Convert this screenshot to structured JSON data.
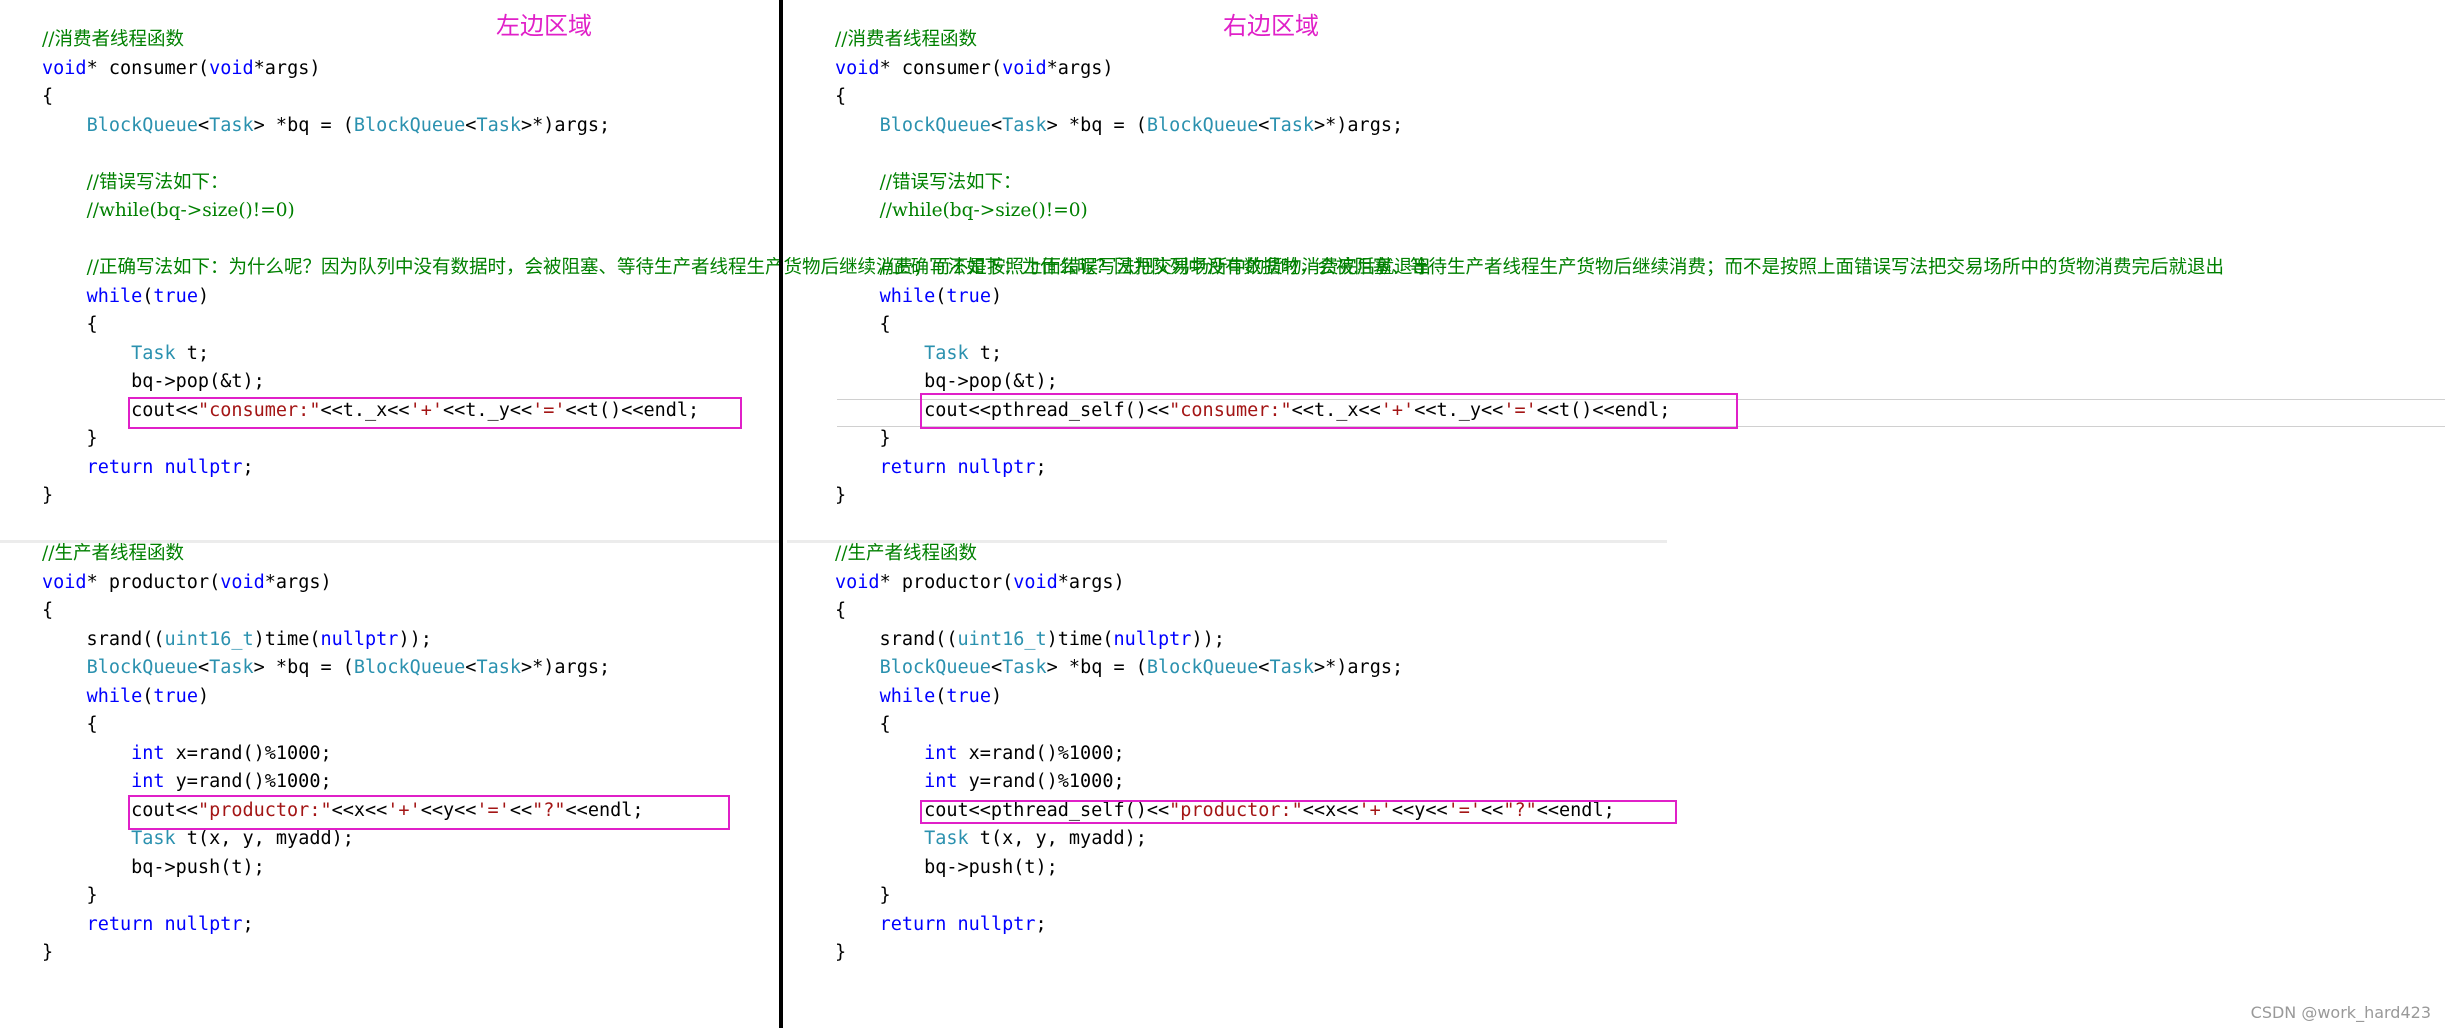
{
  "labels": {
    "left": "左边区域",
    "right": "右边区域"
  },
  "watermark": "CSDN @work_hard423",
  "colors": {
    "highlight_box": "#e020c8",
    "keyword": "#0000ff",
    "type": "#2b91af",
    "comment": "#008000",
    "string": "#a31515"
  },
  "left": {
    "consumer": [
      [
        [
          "cm",
          "//消费者线程函数"
        ]
      ],
      [
        [
          "kw",
          "void"
        ],
        [
          "",
          "* consumer("
        ],
        [
          "kw",
          "void"
        ],
        [
          "",
          "*args)"
        ]
      ],
      [
        [
          "",
          "{"
        ]
      ],
      [
        [
          "",
          "    "
        ],
        [
          "ty",
          "BlockQueue"
        ],
        [
          "",
          "<"
        ],
        [
          "ty",
          "Task"
        ],
        [
          "",
          "> *bq = ("
        ],
        [
          "ty",
          "BlockQueue"
        ],
        [
          "",
          "<"
        ],
        [
          "ty",
          "Task"
        ],
        [
          "",
          ">*)args;"
        ]
      ],
      [
        [
          "",
          ""
        ]
      ],
      [
        [
          "",
          "    "
        ],
        [
          "cm",
          "//错误写法如下："
        ]
      ],
      [
        [
          "",
          "    "
        ],
        [
          "cm",
          "//while(bq->size()!=0)"
        ]
      ],
      [
        [
          "",
          ""
        ]
      ],
      [
        [
          "",
          "    "
        ],
        [
          "cm",
          "//正确写法如下：为什么呢？因为队列中没有数据时，会被阻塞、等待生产者线程生产货物后继续消费；而不是按照上面错误写法把交易场所中的货物消费完后就退出"
        ]
      ],
      [
        [
          "",
          "    "
        ],
        [
          "kw",
          "while"
        ],
        [
          "",
          "("
        ],
        [
          "kw",
          "true"
        ],
        [
          "",
          ")"
        ]
      ],
      [
        [
          "",
          "    {"
        ]
      ],
      [
        [
          "",
          "        "
        ],
        [
          "ty",
          "Task"
        ],
        [
          "",
          " t;"
        ]
      ],
      [
        [
          "",
          "        bq->pop(&t);"
        ]
      ],
      [
        [
          "",
          "        cout<<"
        ],
        [
          "str",
          "\"consumer:\""
        ],
        [
          "",
          "<<t._x<<"
        ],
        [
          "str",
          "'+'"
        ],
        [
          "",
          "<<t._y<<"
        ],
        [
          "str",
          "'='"
        ],
        [
          "",
          "<<t()<<endl;"
        ]
      ],
      [
        [
          "",
          "    }"
        ]
      ],
      [
        [
          "",
          "    "
        ],
        [
          "kw",
          "return"
        ],
        [
          "",
          " "
        ],
        [
          "kw",
          "nullptr"
        ],
        [
          "",
          ";"
        ]
      ],
      [
        [
          "",
          "}"
        ]
      ]
    ],
    "producer": [
      [
        [
          "cm",
          "//生产者线程函数"
        ]
      ],
      [
        [
          "kw",
          "void"
        ],
        [
          "",
          "* productor("
        ],
        [
          "kw",
          "void"
        ],
        [
          "",
          "*args)"
        ]
      ],
      [
        [
          "",
          "{"
        ]
      ],
      [
        [
          "",
          "    srand(("
        ],
        [
          "ty",
          "uint16_t"
        ],
        [
          "",
          ")time("
        ],
        [
          "kw",
          "nullptr"
        ],
        [
          "",
          "));"
        ]
      ],
      [
        [
          "",
          "    "
        ],
        [
          "ty",
          "BlockQueue"
        ],
        [
          "",
          "<"
        ],
        [
          "ty",
          "Task"
        ],
        [
          "",
          "> *bq = ("
        ],
        [
          "ty",
          "BlockQueue"
        ],
        [
          "",
          "<"
        ],
        [
          "ty",
          "Task"
        ],
        [
          "",
          ">*)args;"
        ]
      ],
      [
        [
          "",
          "    "
        ],
        [
          "kw",
          "while"
        ],
        [
          "",
          "("
        ],
        [
          "kw",
          "true"
        ],
        [
          "",
          ")"
        ]
      ],
      [
        [
          "",
          "    {"
        ]
      ],
      [
        [
          "",
          "        "
        ],
        [
          "kw",
          "int"
        ],
        [
          "",
          " x=rand()%1000;"
        ]
      ],
      [
        [
          "",
          "        "
        ],
        [
          "kw",
          "int"
        ],
        [
          "",
          " y=rand()%1000;"
        ]
      ],
      [
        [
          "",
          "        cout<<"
        ],
        [
          "str",
          "\"productor:\""
        ],
        [
          "",
          "<<x<<"
        ],
        [
          "str",
          "'+'"
        ],
        [
          "",
          "<<y<<"
        ],
        [
          "str",
          "'='"
        ],
        [
          "",
          "<<"
        ],
        [
          "str",
          "\"?\""
        ],
        [
          "",
          "<<endl;"
        ]
      ],
      [
        [
          "",
          "        "
        ],
        [
          "ty",
          "Task"
        ],
        [
          "",
          " t(x, y, myadd);"
        ]
      ],
      [
        [
          "",
          "        bq->push(t);"
        ]
      ],
      [
        [
          "",
          "    }"
        ]
      ],
      [
        [
          "",
          "    "
        ],
        [
          "kw",
          "return"
        ],
        [
          "",
          " "
        ],
        [
          "kw",
          "nullptr"
        ],
        [
          "",
          ";"
        ]
      ],
      [
        [
          "",
          "}"
        ]
      ]
    ]
  },
  "right": {
    "consumer": [
      [
        [
          "cm",
          "//消费者线程函数"
        ]
      ],
      [
        [
          "kw",
          "void"
        ],
        [
          "",
          "* consumer("
        ],
        [
          "kw",
          "void"
        ],
        [
          "",
          "*args)"
        ]
      ],
      [
        [
          "",
          "{"
        ]
      ],
      [
        [
          "",
          "    "
        ],
        [
          "ty",
          "BlockQueue"
        ],
        [
          "",
          "<"
        ],
        [
          "ty",
          "Task"
        ],
        [
          "",
          "> *bq = ("
        ],
        [
          "ty",
          "BlockQueue"
        ],
        [
          "",
          "<"
        ],
        [
          "ty",
          "Task"
        ],
        [
          "",
          ">*)args;"
        ]
      ],
      [
        [
          "",
          ""
        ]
      ],
      [
        [
          "",
          "    "
        ],
        [
          "cm",
          "//错误写法如下："
        ]
      ],
      [
        [
          "",
          "    "
        ],
        [
          "cm",
          "//while(bq->size()!=0)"
        ]
      ],
      [
        [
          "",
          ""
        ]
      ],
      [
        [
          "",
          "    "
        ],
        [
          "cm",
          "//正确写法如下：为什么呢？因为队列中没有数据时，会被阻塞、等待生产者线程生产货物后继续消费；而不是按照上面错误写法把交易场所中的货物消费完后就退出"
        ]
      ],
      [
        [
          "",
          "    "
        ],
        [
          "kw",
          "while"
        ],
        [
          "",
          "("
        ],
        [
          "kw",
          "true"
        ],
        [
          "",
          ")"
        ]
      ],
      [
        [
          "",
          "    {"
        ]
      ],
      [
        [
          "",
          "        "
        ],
        [
          "ty",
          "Task"
        ],
        [
          "",
          " t;"
        ]
      ],
      [
        [
          "",
          "        bq->pop(&t);"
        ]
      ],
      [
        [
          "",
          "        cout<<pthread_self()<<"
        ],
        [
          "str",
          "\"consumer:\""
        ],
        [
          "",
          "<<t._x<<"
        ],
        [
          "str",
          "'+'"
        ],
        [
          "",
          "<<t._y<<"
        ],
        [
          "str",
          "'='"
        ],
        [
          "",
          "<<t()<<endl;"
        ]
      ],
      [
        [
          "",
          "    }"
        ]
      ],
      [
        [
          "",
          "    "
        ],
        [
          "kw",
          "return"
        ],
        [
          "",
          " "
        ],
        [
          "kw",
          "nullptr"
        ],
        [
          "",
          ";"
        ]
      ],
      [
        [
          "",
          "}"
        ]
      ]
    ],
    "producer": [
      [
        [
          "cm",
          "//生产者线程函数"
        ]
      ],
      [
        [
          "kw",
          "void"
        ],
        [
          "",
          "* productor("
        ],
        [
          "kw",
          "void"
        ],
        [
          "",
          "*args)"
        ]
      ],
      [
        [
          "",
          "{"
        ]
      ],
      [
        [
          "",
          "    srand(("
        ],
        [
          "ty",
          "uint16_t"
        ],
        [
          "",
          ")time("
        ],
        [
          "kw",
          "nullptr"
        ],
        [
          "",
          "));"
        ]
      ],
      [
        [
          "",
          "    "
        ],
        [
          "ty",
          "BlockQueue"
        ],
        [
          "",
          "<"
        ],
        [
          "ty",
          "Task"
        ],
        [
          "",
          "> *bq = ("
        ],
        [
          "ty",
          "BlockQueue"
        ],
        [
          "",
          "<"
        ],
        [
          "ty",
          "Task"
        ],
        [
          "",
          ">*)args;"
        ]
      ],
      [
        [
          "",
          "    "
        ],
        [
          "kw",
          "while"
        ],
        [
          "",
          "("
        ],
        [
          "kw",
          "true"
        ],
        [
          "",
          ")"
        ]
      ],
      [
        [
          "",
          "    {"
        ]
      ],
      [
        [
          "",
          "        "
        ],
        [
          "kw",
          "int"
        ],
        [
          "",
          " x=rand()%1000;"
        ]
      ],
      [
        [
          "",
          "        "
        ],
        [
          "kw",
          "int"
        ],
        [
          "",
          " y=rand()%1000;"
        ]
      ],
      [
        [
          "",
          "        cout<<pthread_self()<<"
        ],
        [
          "str",
          "\"productor:\""
        ],
        [
          "",
          "<<x<<"
        ],
        [
          "str",
          "'+'"
        ],
        [
          "",
          "<<y<<"
        ],
        [
          "str",
          "'='"
        ],
        [
          "",
          "<<"
        ],
        [
          "str",
          "\"?\""
        ],
        [
          "",
          "<<endl;"
        ]
      ],
      [
        [
          "",
          "        "
        ],
        [
          "ty",
          "Task"
        ],
        [
          "",
          " t(x, y, myadd);"
        ]
      ],
      [
        [
          "",
          "        bq->push(t);"
        ]
      ],
      [
        [
          "",
          "    }"
        ]
      ],
      [
        [
          "",
          "    "
        ],
        [
          "kw",
          "return"
        ],
        [
          "",
          " "
        ],
        [
          "kw",
          "nullptr"
        ],
        [
          "",
          ";"
        ]
      ],
      [
        [
          "",
          "}"
        ]
      ]
    ]
  }
}
